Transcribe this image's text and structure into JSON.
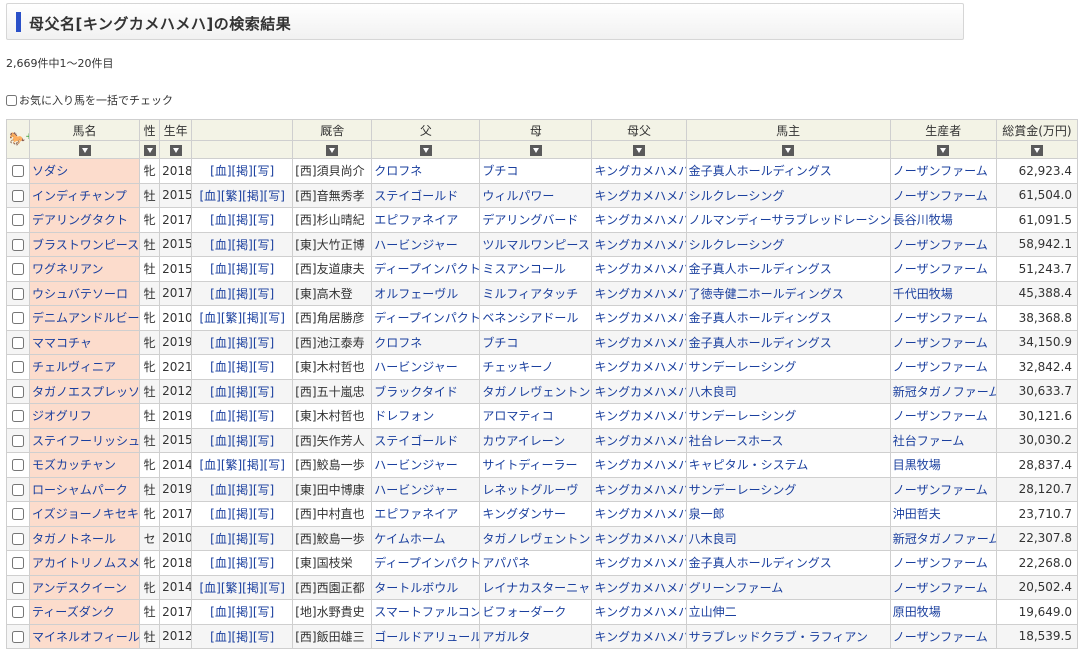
{
  "header": {
    "title": "母父名[キングカメハメハ]の検索結果"
  },
  "result_count": "2,669件中1～20件目",
  "fav_check_label": "お気に入り馬を一括でチェック",
  "columns": [
    "馬名",
    "性",
    "生年",
    "",
    "厩舎",
    "父",
    "母",
    "母父",
    "馬主",
    "生産者",
    "総賞金(万円)"
  ],
  "icons": {
    "header_icon": "add-horse-icon",
    "sort": "sort-down-icon"
  },
  "rows": [
    {
      "name": "ソダシ",
      "sex": "牝",
      "year": "2018",
      "tags": "[血][掲][写]",
      "trainer": "[西]須貝尚介",
      "sire": "クロフネ",
      "dam": "ブチコ",
      "damsire": "キングカメハメハ",
      "owner": "金子真人ホールディングス",
      "breeder": "ノーザンファーム",
      "prize": "62,923.4"
    },
    {
      "name": "インディチャンプ",
      "sex": "牡",
      "year": "2015",
      "tags": "[血][繁][掲][写]",
      "trainer": "[西]音無秀孝",
      "sire": "ステイゴールド",
      "dam": "ウィルパワー",
      "damsire": "キングカメハメハ",
      "owner": "シルクレーシング",
      "breeder": "ノーザンファーム",
      "prize": "61,504.0"
    },
    {
      "name": "デアリングタクト",
      "sex": "牝",
      "year": "2017",
      "tags": "[血][掲][写]",
      "trainer": "[西]杉山晴紀",
      "sire": "エピファネイア",
      "dam": "デアリングバード",
      "damsire": "キングカメハメハ",
      "owner": "ノルマンディーサラブレッドレーシング",
      "breeder": "長谷川牧場",
      "prize": "61,091.5"
    },
    {
      "name": "ブラストワンピース",
      "sex": "牡",
      "year": "2015",
      "tags": "[血][掲][写]",
      "trainer": "[東]大竹正博",
      "sire": "ハービンジャー",
      "dam": "ツルマルワンピース",
      "damsire": "キングカメハメハ",
      "owner": "シルクレーシング",
      "breeder": "ノーザンファーム",
      "prize": "58,942.1"
    },
    {
      "name": "ワグネリアン",
      "sex": "牡",
      "year": "2015",
      "tags": "[血][掲][写]",
      "trainer": "[西]友道康夫",
      "sire": "ディープインパクト",
      "dam": "ミスアンコール",
      "damsire": "キングカメハメハ",
      "owner": "金子真人ホールディングス",
      "breeder": "ノーザンファーム",
      "prize": "51,243.7"
    },
    {
      "name": "ウシュバテソーロ",
      "sex": "牡",
      "year": "2017",
      "tags": "[血][掲][写]",
      "trainer": "[東]高木登",
      "sire": "オルフェーヴル",
      "dam": "ミルフィアタッチ",
      "damsire": "キングカメハメハ",
      "owner": "了徳寺健二ホールディングス",
      "breeder": "千代田牧場",
      "prize": "45,388.4"
    },
    {
      "name": "デニムアンドルビー",
      "sex": "牝",
      "year": "2010",
      "tags": "[血][繁][掲][写]",
      "trainer": "[西]角居勝彦",
      "sire": "ディープインパクト",
      "dam": "ベネンシアドール",
      "damsire": "キングカメハメハ",
      "owner": "金子真人ホールディングス",
      "breeder": "ノーザンファーム",
      "prize": "38,368.8"
    },
    {
      "name": "ママコチャ",
      "sex": "牝",
      "year": "2019",
      "tags": "[血][掲][写]",
      "trainer": "[西]池江泰寿",
      "sire": "クロフネ",
      "dam": "ブチコ",
      "damsire": "キングカメハメハ",
      "owner": "金子真人ホールディングス",
      "breeder": "ノーザンファーム",
      "prize": "34,150.9"
    },
    {
      "name": "チェルヴィニア",
      "sex": "牝",
      "year": "2021",
      "tags": "[血][掲][写]",
      "trainer": "[東]木村哲也",
      "sire": "ハービンジャー",
      "dam": "チェッキーノ",
      "damsire": "キングカメハメハ",
      "owner": "サンデーレーシング",
      "breeder": "ノーザンファーム",
      "prize": "32,842.4"
    },
    {
      "name": "タガノエスプレッソ",
      "sex": "牡",
      "year": "2012",
      "tags": "[血][掲][写]",
      "trainer": "[西]五十嵐忠",
      "sire": "ブラックタイド",
      "dam": "タガノレヴェントン",
      "damsire": "キングカメハメハ",
      "owner": "八木良司",
      "breeder": "新冠タガノファーム",
      "prize": "30,633.7"
    },
    {
      "name": "ジオグリフ",
      "sex": "牡",
      "year": "2019",
      "tags": "[血][掲][写]",
      "trainer": "[東]木村哲也",
      "sire": "ドレフォン",
      "dam": "アロマティコ",
      "damsire": "キングカメハメハ",
      "owner": "サンデーレーシング",
      "breeder": "ノーザンファーム",
      "prize": "30,121.6"
    },
    {
      "name": "ステイフーリッシュ",
      "sex": "牡",
      "year": "2015",
      "tags": "[血][掲][写]",
      "trainer": "[西]矢作芳人",
      "sire": "ステイゴールド",
      "dam": "カウアイレーン",
      "damsire": "キングカメハメハ",
      "owner": "社台レースホース",
      "breeder": "社台ファーム",
      "prize": "30,030.2"
    },
    {
      "name": "モズカッチャン",
      "sex": "牝",
      "year": "2014",
      "tags": "[血][繁][掲][写]",
      "trainer": "[西]鮫島一歩",
      "sire": "ハービンジャー",
      "dam": "サイトディーラー",
      "damsire": "キングカメハメハ",
      "owner": "キャピタル・システム",
      "breeder": "目黒牧場",
      "prize": "28,837.4"
    },
    {
      "name": "ローシャムパーク",
      "sex": "牡",
      "year": "2019",
      "tags": "[血][掲][写]",
      "trainer": "[東]田中博康",
      "sire": "ハービンジャー",
      "dam": "レネットグルーヴ",
      "damsire": "キングカメハメハ",
      "owner": "サンデーレーシング",
      "breeder": "ノーザンファーム",
      "prize": "28,120.7"
    },
    {
      "name": "イズジョーノキセキ",
      "sex": "牝",
      "year": "2017",
      "tags": "[血][掲][写]",
      "trainer": "[西]中村直也",
      "sire": "エピファネイア",
      "dam": "キングダンサー",
      "damsire": "キングカメハメハ",
      "owner": "泉一郎",
      "breeder": "沖田哲夫",
      "prize": "23,710.7"
    },
    {
      "name": "タガノトネール",
      "sex": "セ",
      "year": "2010",
      "tags": "[血][掲][写]",
      "trainer": "[西]鮫島一歩",
      "sire": "ケイムホーム",
      "dam": "タガノレヴェントン",
      "damsire": "キングカメハメハ",
      "owner": "八木良司",
      "breeder": "新冠タガノファーム",
      "prize": "22,307.8"
    },
    {
      "name": "アカイトリノムスメ",
      "sex": "牝",
      "year": "2018",
      "tags": "[血][掲][写]",
      "trainer": "[東]国枝栄",
      "sire": "ディープインパクト",
      "dam": "アパパネ",
      "damsire": "キングカメハメハ",
      "owner": "金子真人ホールディングス",
      "breeder": "ノーザンファーム",
      "prize": "22,268.0"
    },
    {
      "name": "アンデスクイーン",
      "sex": "牝",
      "year": "2014",
      "tags": "[血][繁][掲][写]",
      "trainer": "[西]西園正都",
      "sire": "タートルボウル",
      "dam": "レイナカスターニャ",
      "damsire": "キングカメハメハ",
      "owner": "グリーンファーム",
      "breeder": "ノーザンファーム",
      "prize": "20,502.4"
    },
    {
      "name": "ティーズダンク",
      "sex": "牡",
      "year": "2017",
      "tags": "[血][掲][写]",
      "trainer": "[地]水野貴史",
      "sire": "スマートファルコン",
      "dam": "ビフォーダーク",
      "damsire": "キングカメハメハ",
      "owner": "立山伸二",
      "breeder": "原田牧場",
      "prize": "19,649.0"
    },
    {
      "name": "マイネルオフィール",
      "sex": "牡",
      "year": "2012",
      "tags": "[血][掲][写]",
      "trainer": "[西]飯田雄三",
      "sire": "ゴールドアリュール",
      "dam": "アガルタ",
      "damsire": "キングカメハメハ",
      "owner": "サラブレッドクラブ・ラフィアン",
      "breeder": "ノーザンファーム",
      "prize": "18,539.5"
    }
  ]
}
